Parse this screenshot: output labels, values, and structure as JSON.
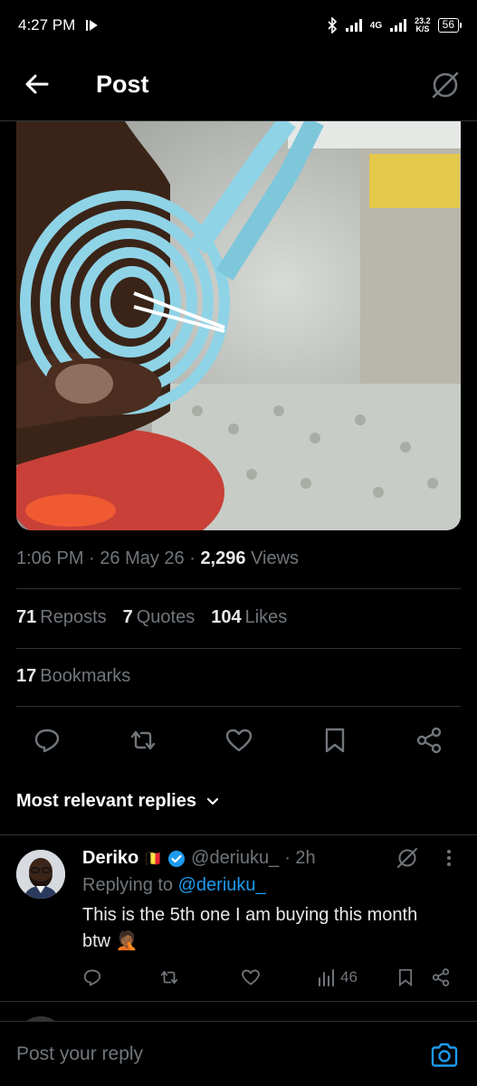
{
  "status_bar": {
    "time": "4:27 PM",
    "network_label": "4G",
    "speed_value": "23.2",
    "speed_unit": "K/S",
    "battery": "56"
  },
  "header": {
    "title": "Post"
  },
  "post": {
    "time": "1:06 PM",
    "date": "26 May 26",
    "views_count": "2,296",
    "views_label": "Views",
    "reposts_count": "71",
    "reposts_label": "Reposts",
    "quotes_count": "7",
    "quotes_label": "Quotes",
    "likes_count": "104",
    "likes_label": "Likes",
    "bookmarks_count": "17",
    "bookmarks_label": "Bookmarks"
  },
  "replies_filter": {
    "label": "Most relevant replies"
  },
  "reply": {
    "name": "Deriko",
    "flag_emoji": "🇧🇪",
    "handle": "@deriuku_",
    "age": "· 2h",
    "replying_to_label": "Replying to",
    "replying_to_handle": "@deriuku_",
    "text": "This is the 5th one I am buying this month btw 🤦🏾",
    "views": "46"
  },
  "compose": {
    "placeholder": "Post your reply"
  },
  "colors": {
    "background": "#000000",
    "accent": "#1d9bf0",
    "muted": "#71767b",
    "divider": "#2f3336",
    "cable": "#8fd3e6"
  }
}
